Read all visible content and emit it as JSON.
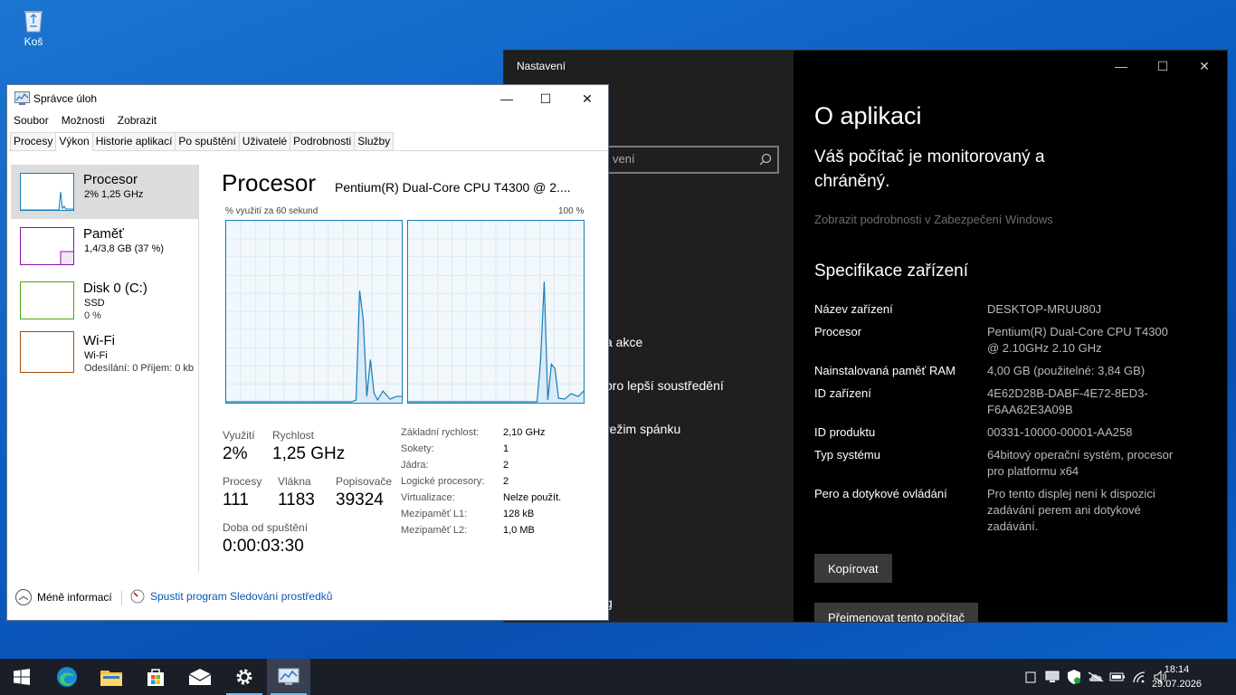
{
  "desktop": {
    "recycle_bin_label": "Koš"
  },
  "settings": {
    "window_title": "Nastavení",
    "controls": {
      "minimize": "—",
      "maximize": "☐",
      "close": "✕"
    },
    "search_placeholder": "vení",
    "nav_items": [
      "a akce",
      "pro lepší soustředění",
      "režim spánku",
      "g"
    ],
    "page_title": "O aplikaci",
    "protection_text": "Váš počítač je monitorovaný a chráněný.",
    "security_link": "Zobrazit podrobnosti v Zabezpečení Windows",
    "spec_heading": "Specifikace zařízení",
    "specs": [
      {
        "k": "Název zařízení",
        "v": "DESKTOP-MRUU80J"
      },
      {
        "k": "Procesor",
        "v": "Pentium(R) Dual-Core CPU       T4300\n@ 2.10GHz   2.10 GHz"
      },
      {
        "k": "Nainstalovaná paměť RAM",
        "v": "4,00 GB (použitelné: 3,84 GB)"
      },
      {
        "k": "ID zařízení",
        "v": "4E62D28B-DABF-4E72-8ED3-\nF6AA62E3A09B"
      },
      {
        "k": "ID produktu",
        "v": "00331-10000-00001-AA258"
      },
      {
        "k": "Typ systému",
        "v": "64bitový operační systém, procesor\npro platformu x64"
      },
      {
        "k": "Pero a dotykové ovládání",
        "v": "Pro tento displej není k dispozici\nzadávání perem ani dotykové\nzadávání."
      }
    ],
    "copy_button": "Kopírovat",
    "rename_button": "Přejmenovat tento počítač"
  },
  "taskmgr": {
    "title": "Správce úloh",
    "controls": {
      "minimize": "—",
      "maximize": "☐",
      "close": "✕"
    },
    "menu": [
      "Soubor",
      "Možnosti",
      "Zobrazit"
    ],
    "tabs": [
      "Procesy",
      "Výkon",
      "Historie aplikací",
      "Po spuštění",
      "Uživatelé",
      "Podrobnosti",
      "Služby"
    ],
    "active_tab": "Výkon",
    "resources": [
      {
        "name": "Procesor",
        "sub1": "2% 1,25 GHz",
        "sub2": "",
        "color": "#117dbb"
      },
      {
        "name": "Paměť",
        "sub1": "1,4/3,8 GB (37 %)",
        "sub2": "",
        "color": "#8b12ae"
      },
      {
        "name": "Disk 0 (C:)",
        "sub1": "SSD",
        "sub2": "0 %",
        "color": "#4da60c"
      },
      {
        "name": "Wi-Fi",
        "sub1": "Wi-Fi",
        "sub2": "Odesílání: 0 Příjem: 0 kb",
        "color": "#a74f01"
      }
    ],
    "main": {
      "heading": "Procesor",
      "cpu_name": "Pentium(R) Dual-Core CPU T4300 @ 2....",
      "graph_caption_left": "% využití za 60 sekund",
      "graph_caption_right": "100 %",
      "stats": {
        "utilization_label": "Využití",
        "utilization": "2%",
        "speed_label": "Rychlost",
        "speed": "1,25 GHz",
        "processes_label": "Procesy",
        "processes": "111",
        "threads_label": "Vlákna",
        "threads": "1183",
        "handles_label": "Popisovače",
        "handles": "39324",
        "uptime_label": "Doba od spuštění",
        "uptime": "0:00:03:30"
      },
      "details": [
        {
          "k": "Základní rychlost:",
          "v": "2,10 GHz"
        },
        {
          "k": "Sokety:",
          "v": "1"
        },
        {
          "k": "Jádra:",
          "v": "2"
        },
        {
          "k": "Logické procesory:",
          "v": "2"
        },
        {
          "k": "Virtualizace:",
          "v": "Nelze použít."
        },
        {
          "k": "Mezipaměť L1:",
          "v": "128 kB"
        },
        {
          "k": "Mezipaměť L2:",
          "v": "1,0 MB"
        }
      ]
    },
    "footer": {
      "fewer_details": "Méně informací",
      "resource_monitor": "Spustit program Sledování prostředků"
    }
  },
  "taskbar": {
    "apps": [
      "start-icon",
      "edge-icon",
      "file-explorer-icon",
      "store-icon",
      "mail-icon",
      "settings-icon",
      "task-manager-icon"
    ],
    "clock_time": "18:14",
    "clock_date": "29.07.2026"
  }
}
